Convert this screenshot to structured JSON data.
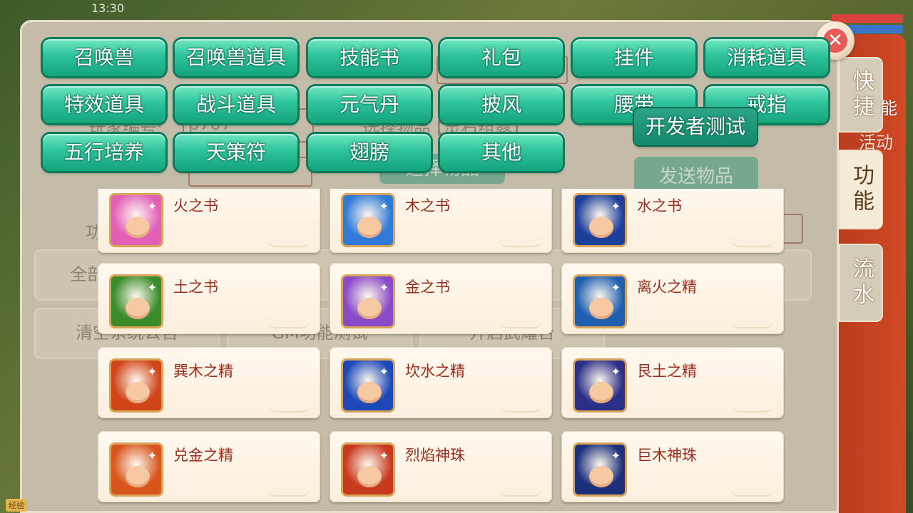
{
  "status": {
    "time": "13:30",
    "exp_label": "经验"
  },
  "background_form": {
    "player_id_label": "玩家编号:",
    "player_id_value": "p707",
    "select_item_label": "选择物品",
    "select_item_value": "【灵石组露】",
    "select_item_button": "选择物品",
    "send_item_button": "发送物品",
    "all_label": "全部",
    "clear_button": "清空系统公告",
    "gm_test_button": "GM功能测试",
    "open_arena_button": "开启武耀台",
    "partial_hint": "功能"
  },
  "side_tabs": [
    {
      "label": "快捷",
      "active": false
    },
    {
      "label": "功能",
      "active": true
    },
    {
      "label": "流水",
      "active": false
    }
  ],
  "side_partial": {
    "activity": "活动",
    "func": "能"
  },
  "categories": [
    [
      "召唤兽",
      "召唤兽道具",
      "技能书",
      "礼包",
      "挂件",
      "消耗道具"
    ],
    [
      "特效道具",
      "战斗道具",
      "元气丹",
      "披风",
      "腰带",
      "戒指"
    ],
    [
      "五行培养",
      "天策符",
      "翅膀",
      "其他"
    ]
  ],
  "dev_button": "开发者测试",
  "items": [
    {
      "name": "火之书",
      "icon": "fire-book-icon",
      "bg": "#e25fb6"
    },
    {
      "name": "木之书",
      "icon": "wood-book-icon",
      "bg": "#2f7ad8"
    },
    {
      "name": "水之书",
      "icon": "water-book-icon",
      "bg": "#1c3f9a"
    },
    {
      "name": "土之书",
      "icon": "earth-book-icon",
      "bg": "#3a8c2a"
    },
    {
      "name": "金之书",
      "icon": "metal-book-icon",
      "bg": "#8a4bc8"
    },
    {
      "name": "离火之精",
      "icon": "li-fire-essence-icon",
      "bg": "#1f5fb0"
    },
    {
      "name": "巽木之精",
      "icon": "xun-wood-essence-icon",
      "bg": "#d04418"
    },
    {
      "name": "坎水之精",
      "icon": "kan-water-essence-icon",
      "bg": "#1d49b8"
    },
    {
      "name": "艮土之精",
      "icon": "gen-earth-essence-icon",
      "bg": "#2b2f86"
    },
    {
      "name": "兑金之精",
      "icon": "dui-metal-essence-icon",
      "bg": "#d8561c"
    },
    {
      "name": "烈焰神珠",
      "icon": "blaze-pearl-icon",
      "bg": "#c83a1e"
    },
    {
      "name": "巨木神珠",
      "icon": "giant-wood-pearl-icon",
      "bg": "#1c2f7a"
    }
  ],
  "colors": {
    "accent_teal": "#2ec39a",
    "item_name": "#9c2d1c",
    "close_red": "#e85a55"
  }
}
